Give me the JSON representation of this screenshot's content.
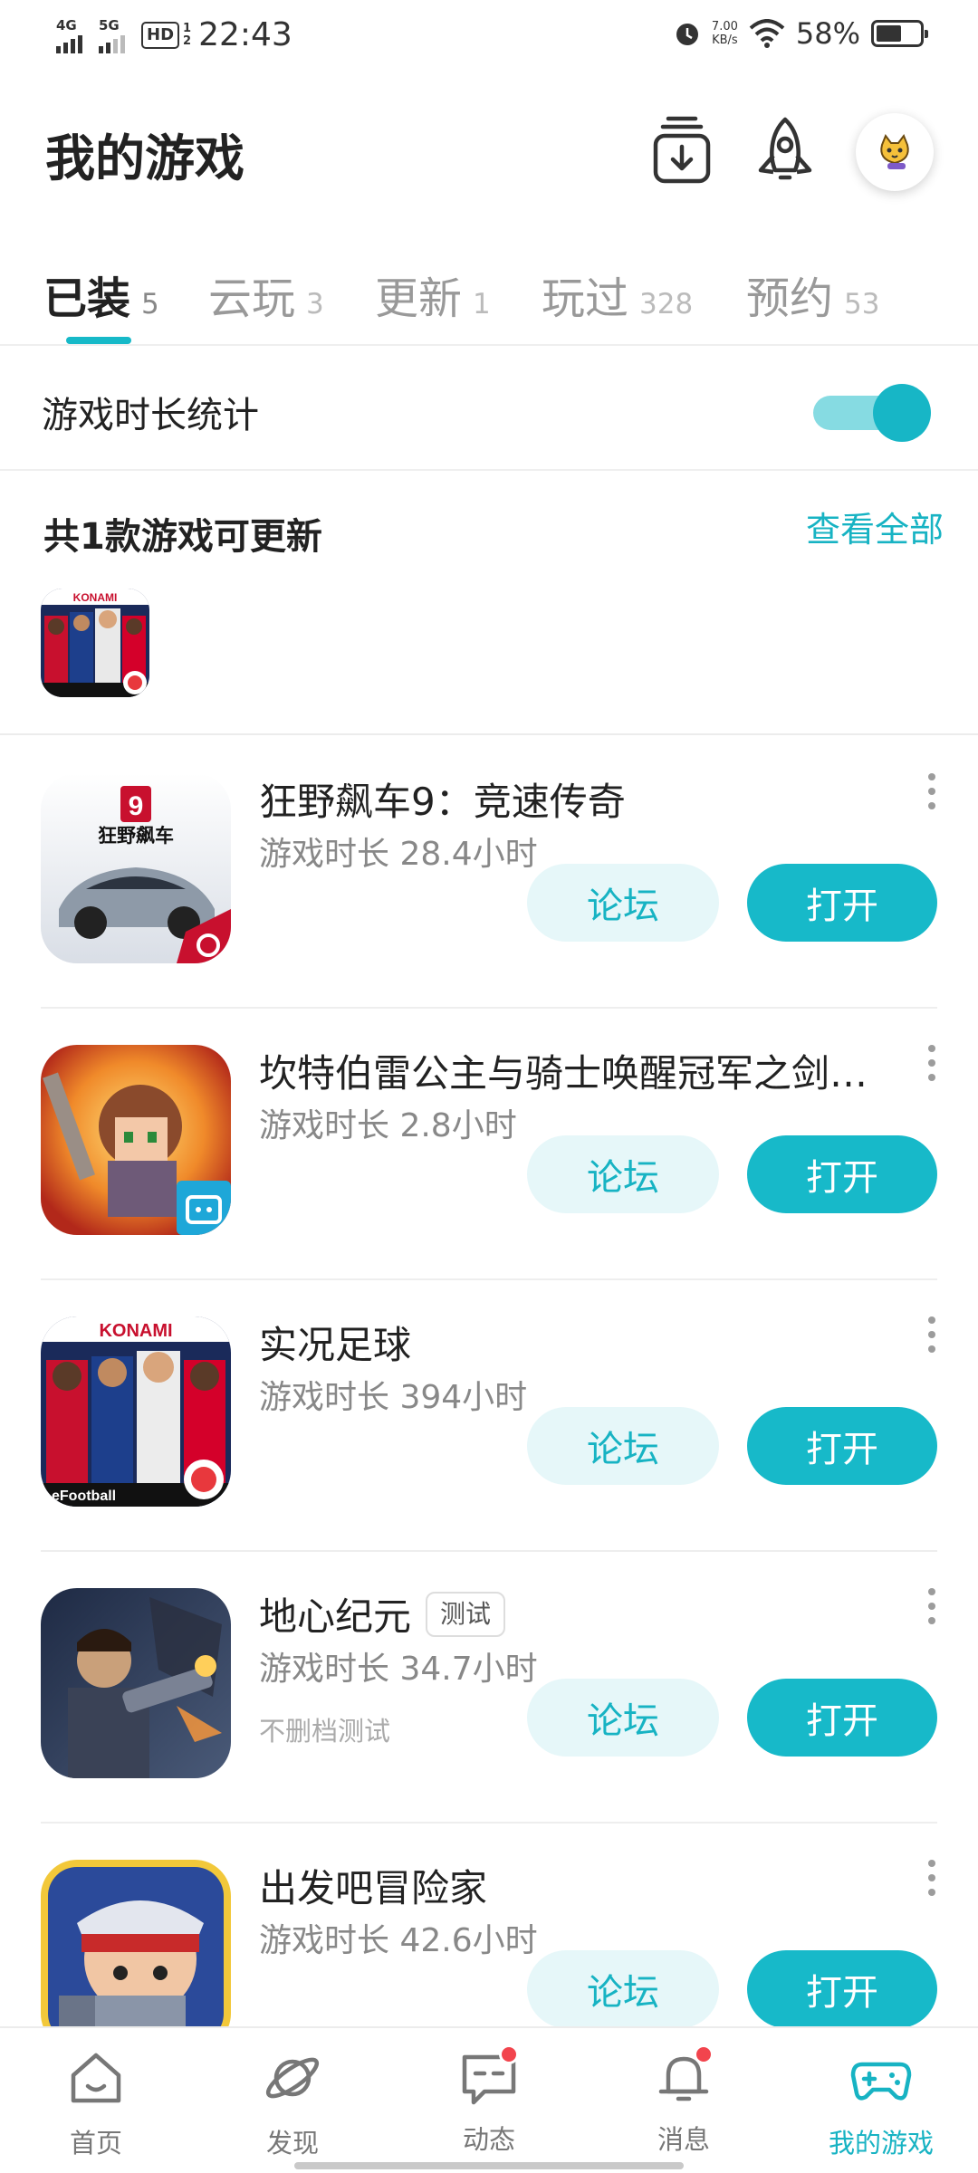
{
  "status_bar": {
    "net1": "4G",
    "net2": "5G",
    "hd": "HD",
    "hd_num": "1\n2",
    "time": "22:43",
    "speed_value": "7.00",
    "speed_unit": "KB/s",
    "battery": "58%",
    "battery_level": 0.58
  },
  "header": {
    "title": "我的游戏",
    "icons": [
      "download-manager-icon",
      "rocket-icon",
      "avatar"
    ]
  },
  "tabs": [
    {
      "label": "已装",
      "count": "5",
      "active": true
    },
    {
      "label": "云玩",
      "count": "3"
    },
    {
      "label": "更新",
      "count": "1"
    },
    {
      "label": "玩过",
      "count": "328"
    },
    {
      "label": "预约",
      "count": "53"
    }
  ],
  "stats": {
    "label": "游戏时长统计",
    "toggle_on": true
  },
  "updates": {
    "title": "共1款游戏可更新",
    "view_all": "查看全部",
    "icon_text": "KONAMI"
  },
  "games": [
    {
      "name": "狂野飙车9：竞速传奇",
      "playtime": "游戏时长 28.4小时",
      "forum": "论坛",
      "open": "打开",
      "icon_text": "狂野飙车"
    },
    {
      "name": "坎特伯雷公主与骑士唤醒冠军之剑…",
      "playtime": "游戏时长 2.8小时",
      "forum": "论坛",
      "open": "打开"
    },
    {
      "name": "实况足球",
      "playtime": "游戏时长 394小时",
      "forum": "论坛",
      "open": "打开",
      "icon_text": "KONAMI",
      "icon_text2": "eFootball"
    },
    {
      "name": "地心纪元",
      "tag": "测试",
      "playtime": "游戏时长 34.7小时",
      "note": "不删档测试",
      "forum": "论坛",
      "open": "打开"
    },
    {
      "name": "出发吧冒险家",
      "playtime": "游戏时长 42.6小时",
      "forum": "论坛",
      "open": "打开"
    }
  ],
  "bottom_nav": [
    {
      "label": "首页",
      "icon": "home-icon"
    },
    {
      "label": "发现",
      "icon": "planet-icon"
    },
    {
      "label": "动态",
      "icon": "chat-icon",
      "badge": true
    },
    {
      "label": "消息",
      "icon": "bell-icon",
      "badge": true
    },
    {
      "label": "我的游戏",
      "icon": "gamepad-icon",
      "active": true
    }
  ],
  "colors": {
    "accent": "#17b9c9",
    "accent_light": "#e6f7f9",
    "badge": "#f2444d"
  }
}
